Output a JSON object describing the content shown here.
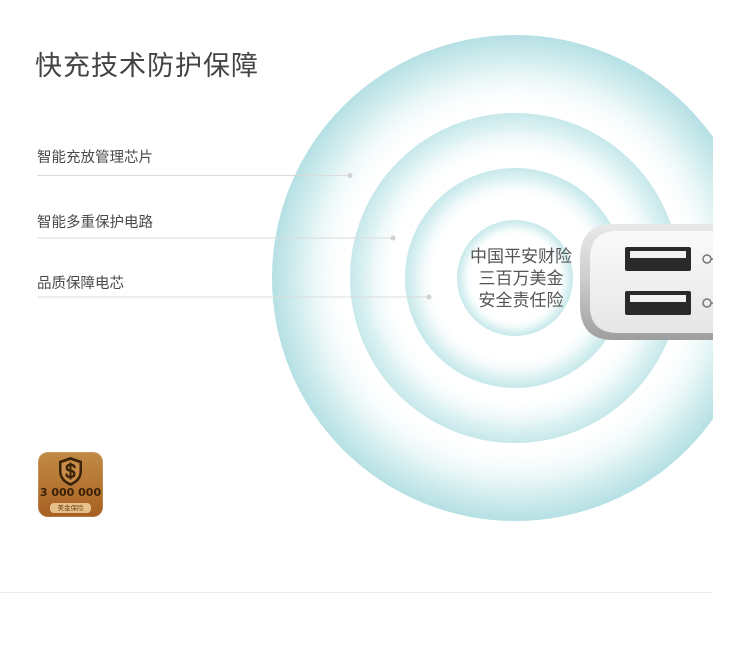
{
  "title": "快充技术防护保障",
  "features": [
    {
      "label": "智能充放管理芯片"
    },
    {
      "label": "智能多重保护电路"
    },
    {
      "label": "品质保障电芯"
    }
  ],
  "guarantee": {
    "line1": "中国平安财险",
    "line2": "三百万美金",
    "line3": "安全责任险"
  },
  "badge": {
    "amount": "3 000 000",
    "sub_label": "美金保险"
  },
  "colors": {
    "ring": "#bfe3e6",
    "badge_orange": "#b57432",
    "title_text": "#444444"
  }
}
